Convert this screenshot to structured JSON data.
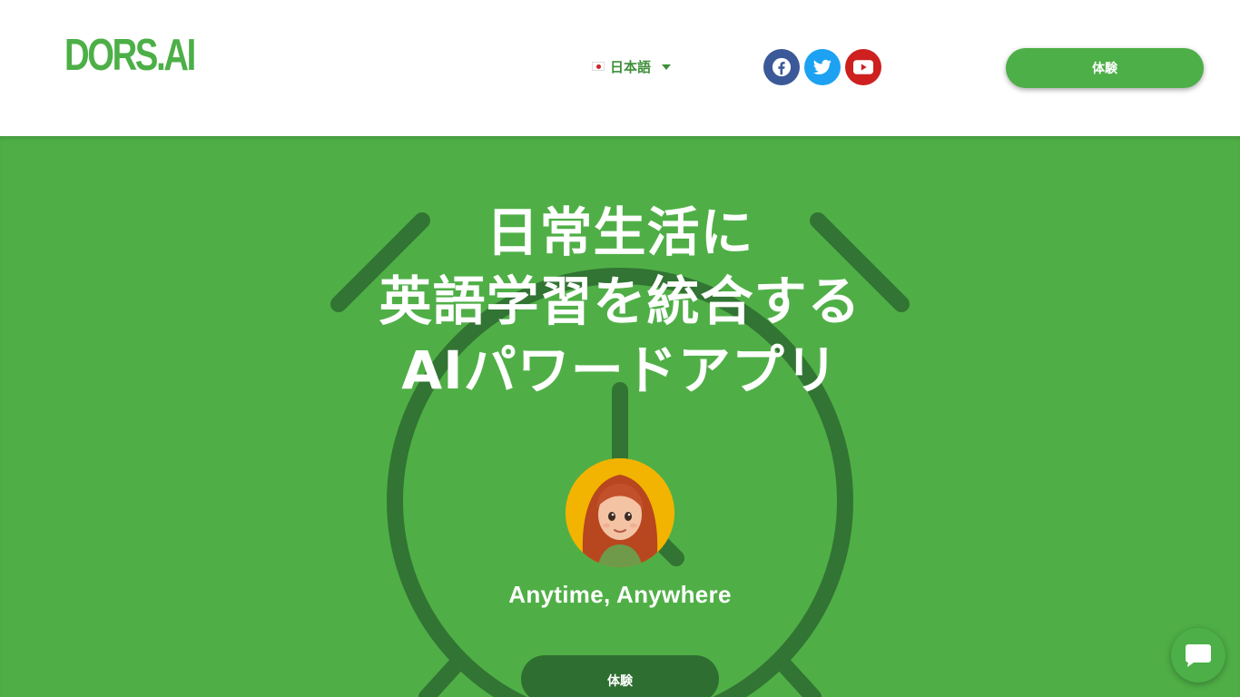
{
  "header": {
    "logo": "DORS.AI",
    "language": {
      "label": "日本語",
      "flag_icon": "japan-flag-icon"
    },
    "social": [
      {
        "name": "facebook",
        "icon": "facebook-icon",
        "color": "#3b5998"
      },
      {
        "name": "twitter",
        "icon": "twitter-icon",
        "color": "#1da1f2"
      },
      {
        "name": "youtube",
        "icon": "youtube-icon",
        "color": "#cd201f"
      }
    ],
    "cta_label": "体験"
  },
  "hero": {
    "headline_line1": "日常生活に",
    "headline_line2": "英語学習を統合する",
    "headline_line3": "AIパワードアプリ",
    "tagline": "Anytime, Anywhere",
    "cta_label": "体験"
  },
  "chat_widget": {
    "icon": "chat-bubble-icon"
  },
  "colors": {
    "brand_green": "#4caf47",
    "hero_bg": "#4faf46",
    "dark_green": "#2f6e31"
  }
}
